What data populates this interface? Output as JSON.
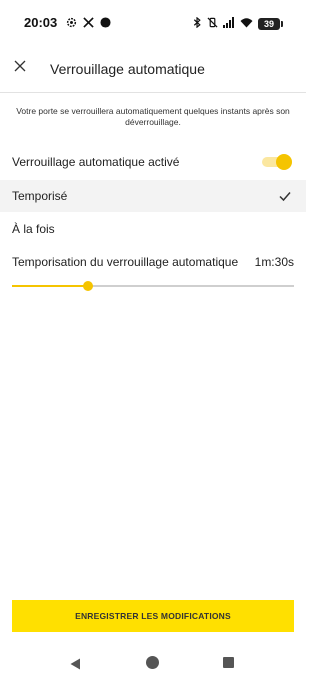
{
  "status_bar": {
    "time": "20:03",
    "battery": "39",
    "left_icons": [
      "settings-gear-icon",
      "x-logo-icon",
      "dot-icon"
    ],
    "right_icons": [
      "bluetooth-icon",
      "vibrate-off-icon",
      "signal-icon",
      "wifi-icon"
    ]
  },
  "header": {
    "title": "Verrouillage automatique",
    "close_icon": "close-icon"
  },
  "description": "Votre porte se verrouillera automatiquement quelques instants après son déverrouillage.",
  "settings": {
    "auto_lock_label": "Verrouillage automatique activé",
    "auto_lock_enabled": true,
    "mode_options": [
      {
        "label": "Temporisé",
        "selected": true
      },
      {
        "label": "À la fois",
        "selected": false
      }
    ],
    "duration_label": "Temporisation du verrouillage automatique",
    "duration_value": "1m:30s",
    "slider_fraction": 0.27
  },
  "save_button": "ENREGISTRER LES MODIFICATIONS",
  "colors": {
    "accent": "#f5c400",
    "button": "#ffe000",
    "selected_row": "#f3f3f3"
  },
  "nav_bar": {
    "icons": [
      "back-triangle-icon",
      "home-circle-icon",
      "recents-square-icon"
    ]
  }
}
